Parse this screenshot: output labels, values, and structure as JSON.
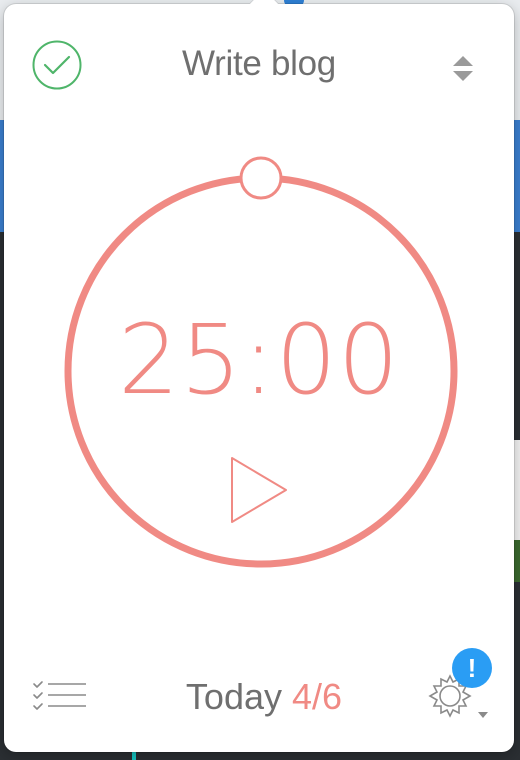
{
  "task": {
    "title": "Write blog",
    "done_icon": "checkmark-circle-icon",
    "sort_icon": "sort-updown-icon"
  },
  "timer": {
    "time": "25:00",
    "progress": 0.0,
    "play_icon": "play-icon"
  },
  "footer": {
    "today_label": "Today",
    "today_count": "4/6",
    "list_icon": "checklist-icon",
    "settings_icon": "gear-icon",
    "badge_text": "!"
  },
  "colors": {
    "accent": "#f08a84",
    "check": "#4fb56a",
    "badge": "#2a9df4",
    "text": "#6f6f6f"
  }
}
